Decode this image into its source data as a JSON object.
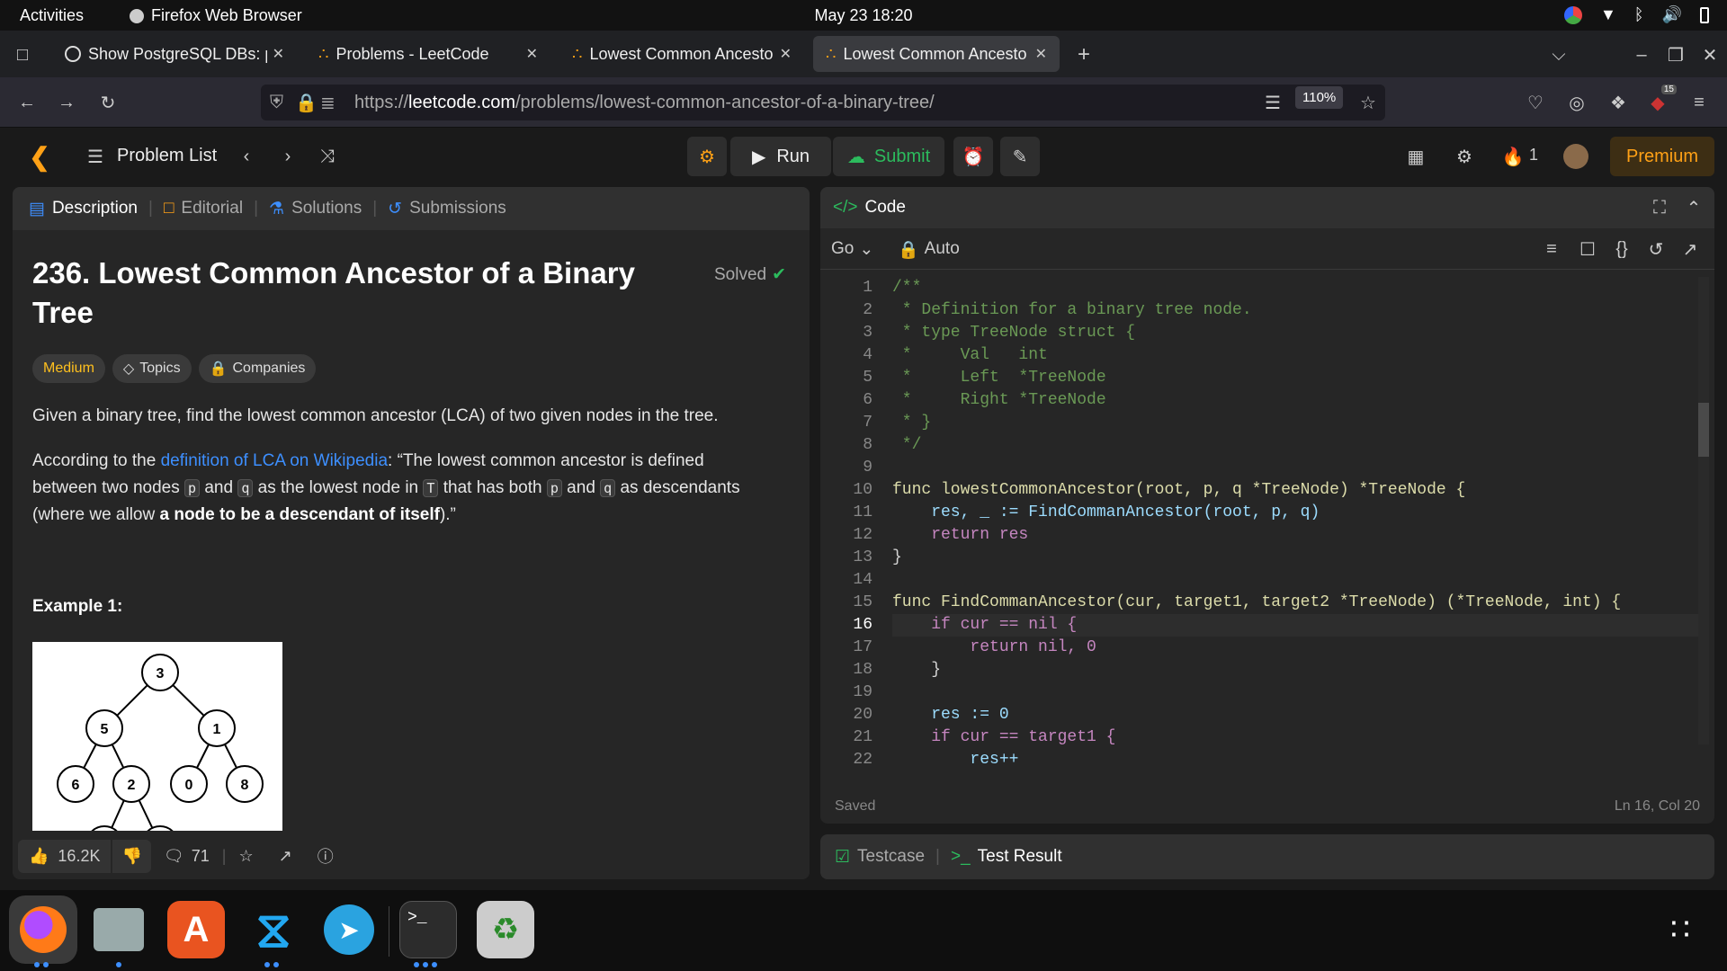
{
  "system": {
    "activities": "Activities",
    "app_name": "Firefox Web Browser",
    "clock": "May 23  18:20"
  },
  "browser": {
    "tabs": [
      {
        "label": "Show PostgreSQL DBs: p"
      },
      {
        "label": "Problems - LeetCode"
      },
      {
        "label": "Lowest Common Ancesto"
      },
      {
        "label": "Lowest Common Ancesto"
      }
    ],
    "url_scheme": "https://",
    "url_host": "leetcode.com",
    "url_path": "/problems/lowest-common-ancestor-of-a-binary-tree/",
    "zoom": "110%",
    "ext_badge": "15"
  },
  "nav": {
    "problem_list": "Problem List",
    "run": "Run",
    "submit": "Submit",
    "streak": "1",
    "premium": "Premium"
  },
  "left": {
    "tabs": [
      "Description",
      "Editorial",
      "Solutions",
      "Submissions"
    ],
    "title_line1": "236. Lowest Common Ancestor of a Binary",
    "title_line2": "Tree",
    "solved": "Solved",
    "difficulty": "Medium",
    "topics": "Topics",
    "companies": "Companies",
    "p1": "Given a binary tree, find the lowest common ancestor (LCA) of two given nodes in the tree.",
    "p2_a": "According to the ",
    "p2_link": "definition of LCA on Wikipedia",
    "p2_b": ": “The lowest common ancestor is defined",
    "p2_c": "between two nodes ",
    "p2_d": " and ",
    "p2_e": " as the lowest node in ",
    "p2_f": " that has both ",
    "p2_g": " and ",
    "p2_h": " as descendants",
    "p2_i": "(where we allow ",
    "p2_bold": "a node to be a descendant of itself",
    "p2_j": ").”",
    "code_p": "p",
    "code_q": "q",
    "code_T": "T",
    "example_title": "Example 1:",
    "tree_nodes": [
      "3",
      "5",
      "1",
      "6",
      "2",
      "0",
      "8"
    ],
    "likes": "16.2K",
    "comments": "71"
  },
  "editor": {
    "header": "Code",
    "language": "Go",
    "mode": "Auto",
    "status": "Saved",
    "cursor": "Ln 16, Col 20",
    "line_numbers": [
      "1",
      "2",
      "3",
      "4",
      "5",
      "6",
      "7",
      "8",
      "9",
      "10",
      "11",
      "12",
      "13",
      "14",
      "15",
      "16",
      "17",
      "18",
      "19",
      "20",
      "21",
      "22"
    ],
    "lines": [
      "/**",
      " * Definition for a binary tree node.",
      " * type TreeNode struct {",
      " *     Val   int",
      " *     Left  *TreeNode",
      " *     Right *TreeNode",
      " * }",
      " */",
      "",
      "func lowestCommonAncestor(root, p, q *TreeNode) *TreeNode {",
      "    res, _ := FindCommanAncestor(root, p, q)",
      "    return res",
      "}",
      "",
      "func FindCommanAncestor(cur, target1, target2 *TreeNode) (*TreeNode, int) {",
      "    if cur == nil {",
      "        return nil, 0",
      "    }",
      "",
      "    res := 0",
      "    if cur == target1 {",
      "        res++"
    ]
  },
  "bottom": {
    "testcase": "Testcase",
    "test_result": "Test Result"
  }
}
